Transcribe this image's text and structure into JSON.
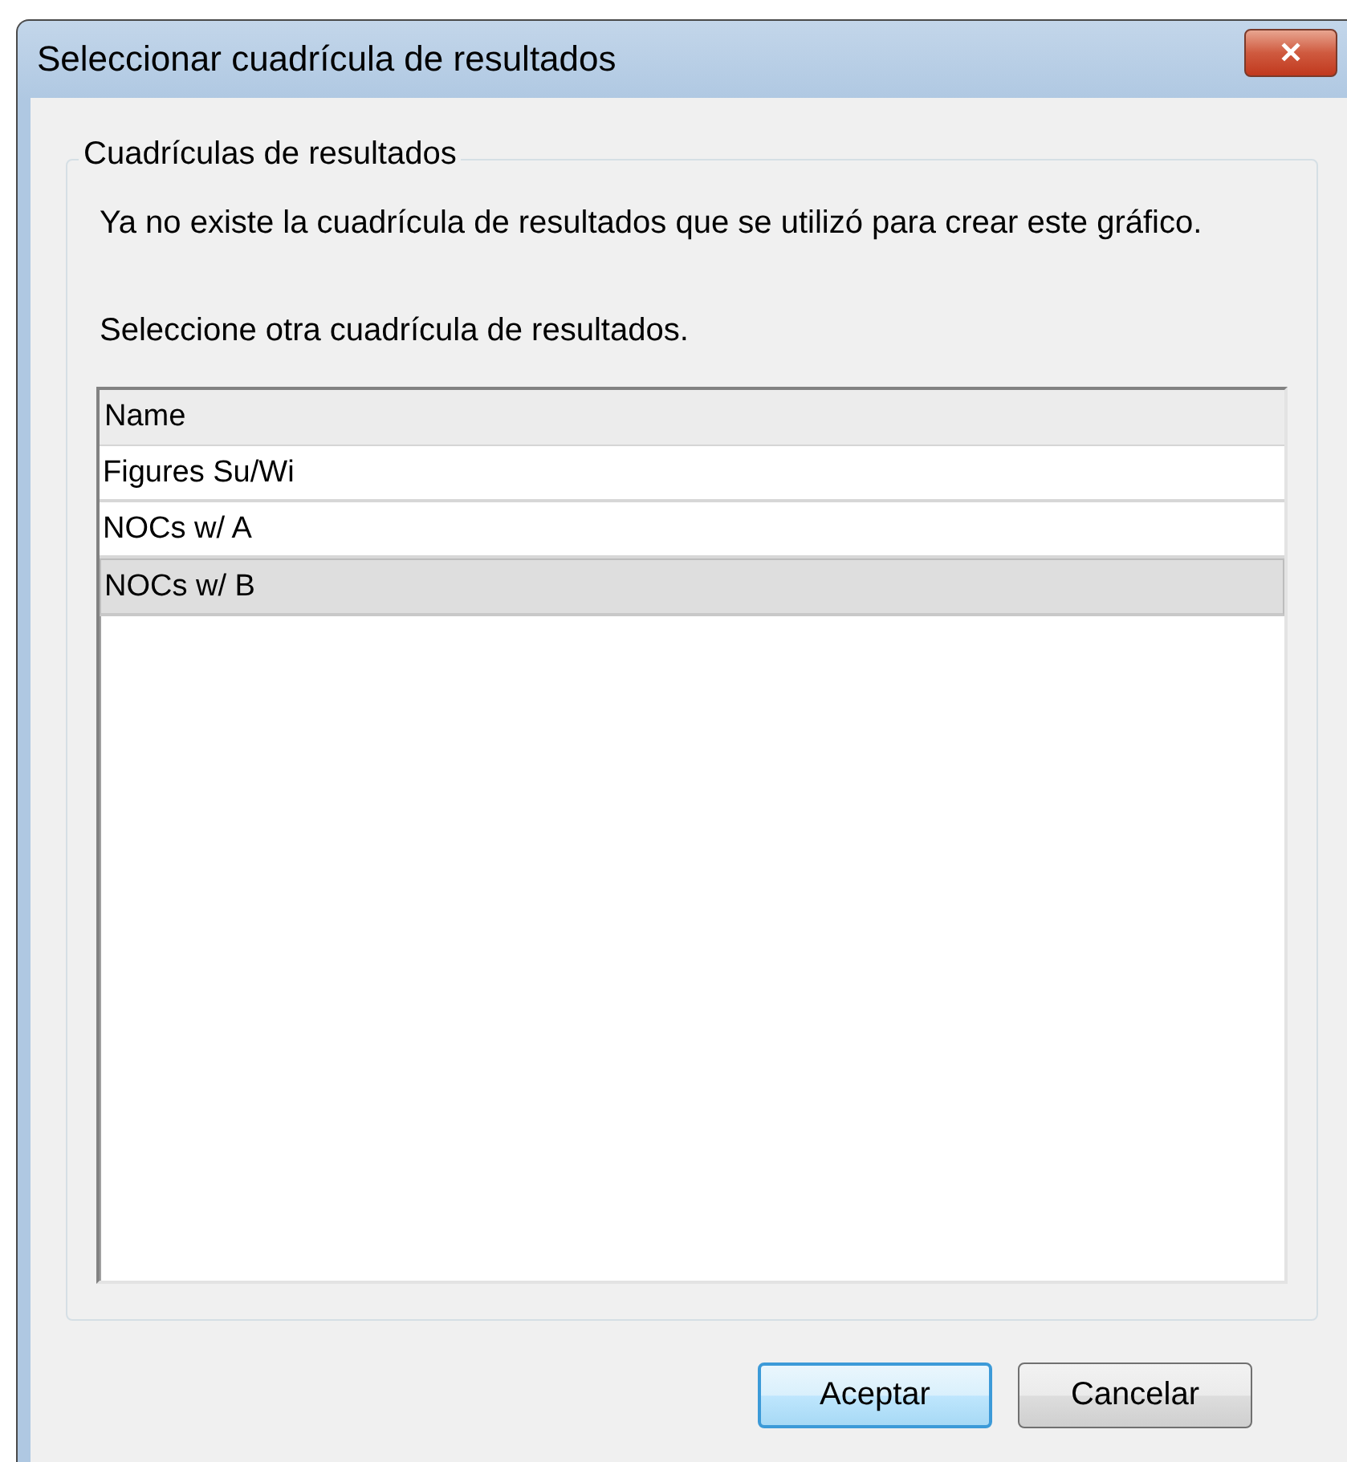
{
  "window": {
    "title": "Seleccionar cuadrícula de resultados",
    "close": "✕"
  },
  "group": {
    "label": "Cuadrículas de resultados",
    "messages": [
      "Ya no existe la cuadrícula de resultados que se utilizó para crear este gráfico.",
      "Seleccione otra cuadrícula de resultados."
    ],
    "list": {
      "columns": [
        "Name"
      ],
      "rows": [
        {
          "name": "Figures Su/Wi",
          "selected": false
        },
        {
          "name": "NOCs w/ A",
          "selected": false
        },
        {
          "name": "NOCs w/ B",
          "selected": true
        }
      ]
    }
  },
  "buttons": [
    {
      "label": "Aceptar",
      "default": true
    },
    {
      "label": "Cancelar",
      "default": false
    }
  ]
}
